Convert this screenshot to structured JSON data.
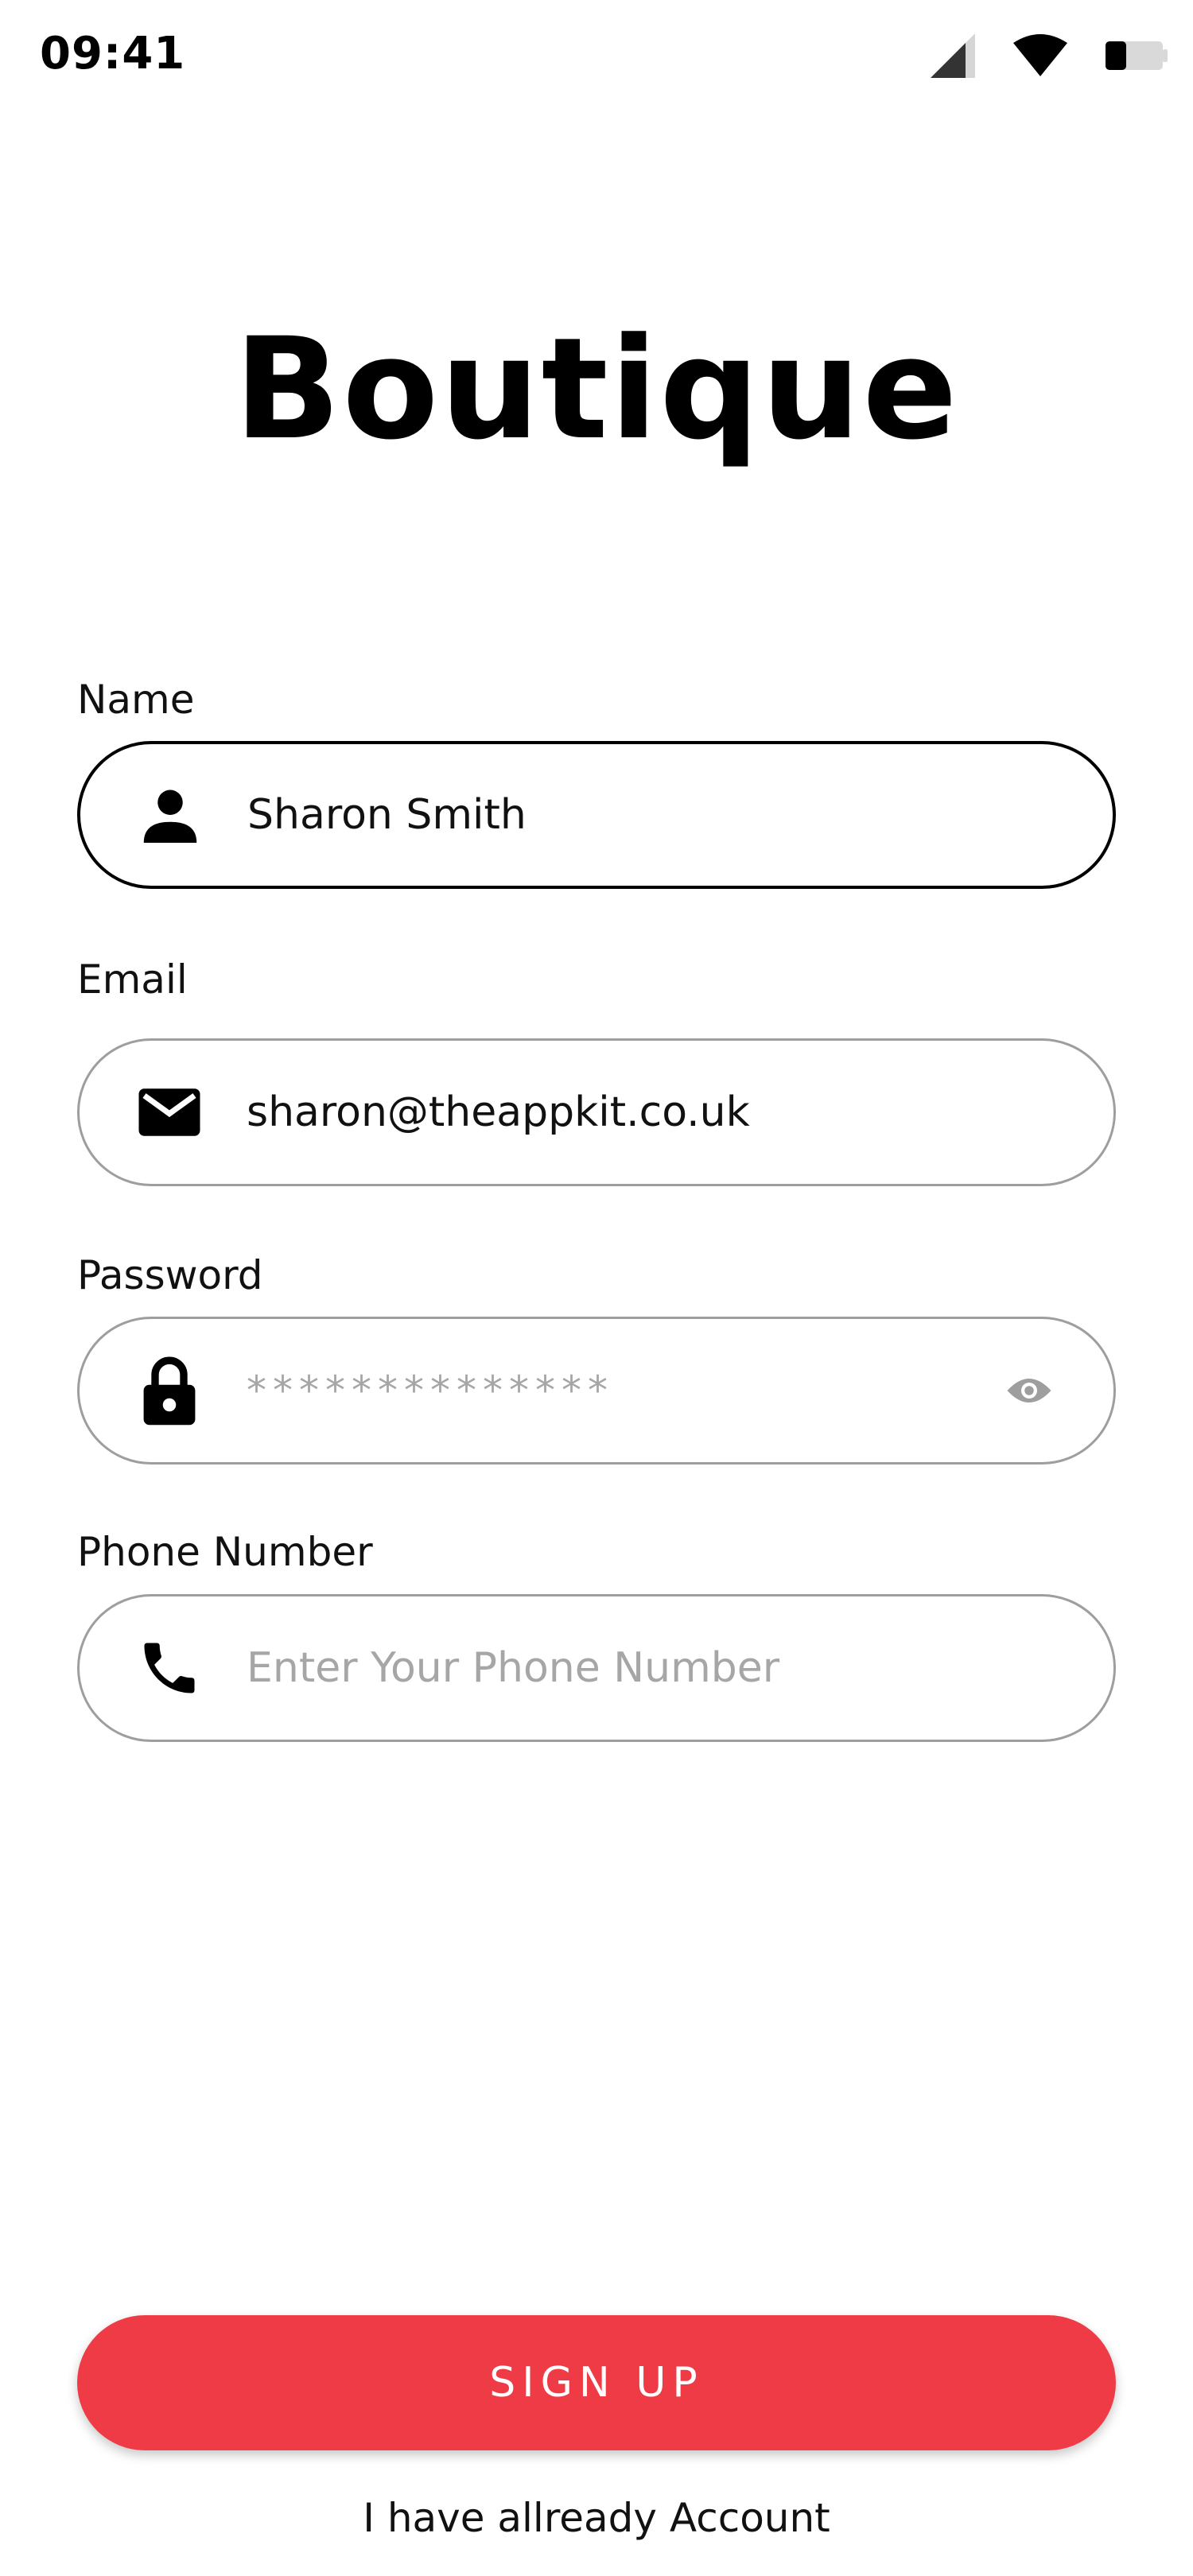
{
  "status_bar": {
    "time": "09:41",
    "icons": [
      "cellular-signal-icon",
      "wifi-icon",
      "battery-icon"
    ]
  },
  "app": {
    "title": "Boutique"
  },
  "form": {
    "name": {
      "label": "Name",
      "value": "Sharon Smith",
      "icon": "person-icon",
      "state": "focused"
    },
    "email": {
      "label": "Email",
      "value": "sharon@theappkit.co.uk",
      "icon": "mail-icon"
    },
    "password": {
      "label": "Password",
      "value": "**************",
      "icon": "lock-icon",
      "toggle_icon": "eye-icon"
    },
    "phone": {
      "label": "Phone Number",
      "placeholder": "Enter Your Phone Number",
      "icon": "phone-icon"
    }
  },
  "actions": {
    "signup_label": "SIGN UP",
    "login_link": "I have allready Account"
  },
  "colors": {
    "accent": "#ef3b45",
    "text": "#111111",
    "border_inactive": "#9e9e9e",
    "border_active": "#000000",
    "placeholder": "#a6a6a6"
  }
}
